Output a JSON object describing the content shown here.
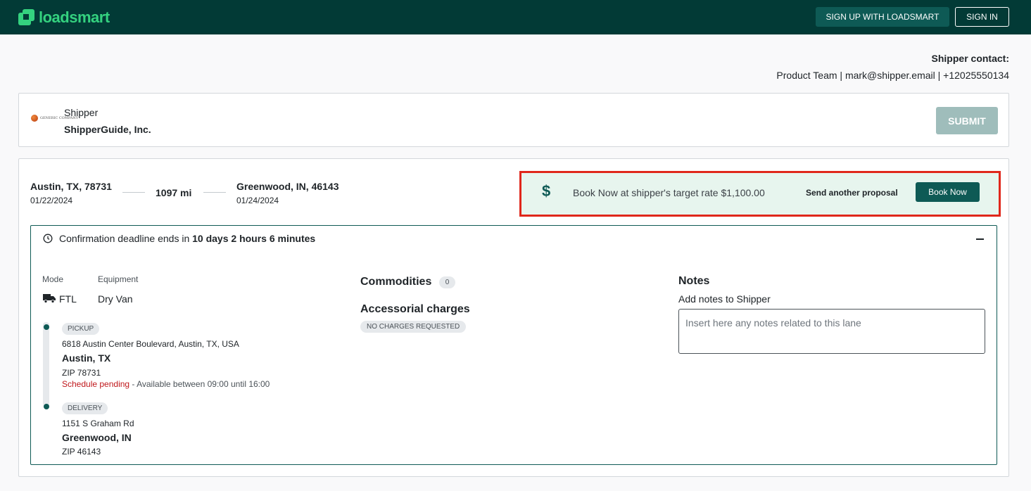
{
  "header": {
    "logo_text": "loadsmart",
    "signup_label": "SIGN UP WITH LOADSMART",
    "signin_label": "SIGN IN",
    "brand_color": "#34d17f",
    "bar_color": "#023a36"
  },
  "contact": {
    "label": "Shipper contact:",
    "info": "Product Team | mark@shipper.email | +12025550134"
  },
  "shipper": {
    "logo_text": "GENERIC COMPANY",
    "label": "Shipper",
    "name": "ShipperGuide, Inc.",
    "submit_label": "SUBMIT"
  },
  "lane": {
    "origin_city": "Austin, TX, 78731",
    "origin_date": "01/22/2024",
    "distance": "1097 mi",
    "dest_city": "Greenwood, IN, 46143",
    "dest_date": "01/24/2024"
  },
  "book": {
    "icon": "dollar-icon",
    "text": "Book Now at shipper's target rate $1,100.00",
    "send_proposal": "Send another proposal",
    "book_now": "Book Now",
    "highlight_color": "#e0271b"
  },
  "deadline": {
    "prefix": "Confirmation deadline ends in",
    "value": "10 days 2 hours 6 minutes"
  },
  "details": {
    "mode_label": "Mode",
    "mode_value": "FTL",
    "equipment_label": "Equipment",
    "equipment_value": "Dry Van"
  },
  "pickup": {
    "badge": "PICKUP",
    "address": "6818 Austin Center Boulevard, Austin, TX, USA",
    "city": "Austin, TX",
    "zip": "ZIP 78731",
    "schedule_status": "Schedule pending",
    "schedule_window": " - Available between 09:00 until 16:00"
  },
  "delivery": {
    "badge": "DELIVERY",
    "address": "1151 S Graham Rd",
    "city": "Greenwood, IN",
    "zip": "ZIP 46143"
  },
  "commodities": {
    "title": "Commodities",
    "count": "0"
  },
  "accessorials": {
    "title": "Accessorial charges",
    "badge": "NO CHARGES REQUESTED"
  },
  "notes": {
    "title": "Notes",
    "subtitle": "Add notes to Shipper",
    "placeholder": "Insert here any notes related to this lane"
  }
}
